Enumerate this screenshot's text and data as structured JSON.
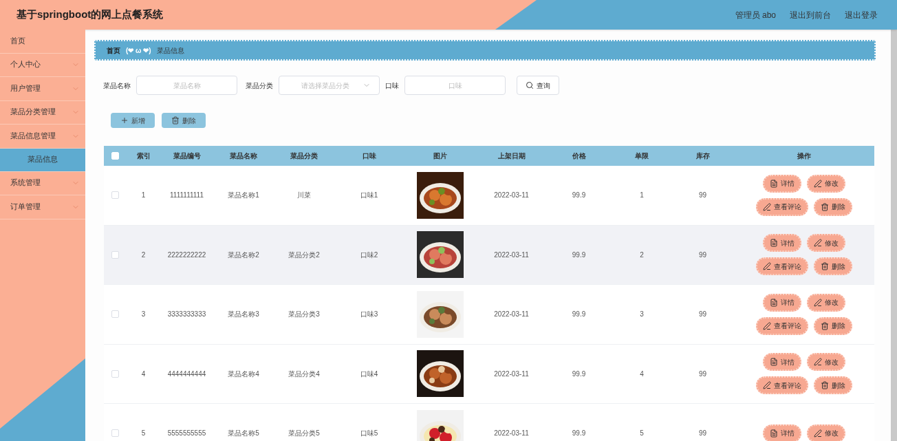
{
  "header": {
    "title": "基于springboot的网上点餐系统",
    "links": [
      "管理员 abo",
      "退出到前台",
      "退出登录"
    ]
  },
  "sidebar": {
    "items": [
      {
        "label": "首页",
        "expandable": false
      },
      {
        "label": "个人中心",
        "expandable": true
      },
      {
        "label": "用户管理",
        "expandable": true
      },
      {
        "label": "菜品分类管理",
        "expandable": true
      },
      {
        "label": "菜品信息管理",
        "expandable": true,
        "children": [
          {
            "label": "菜品信息",
            "selected": true
          }
        ]
      },
      {
        "label": "系统管理",
        "expandable": true
      },
      {
        "label": "订单管理",
        "expandable": true
      }
    ]
  },
  "breadcrumb": {
    "home": "首页",
    "separator": "(❤ ω ❤)",
    "current": "菜品信息"
  },
  "search": {
    "fields": [
      {
        "label": "菜品名称",
        "kind": "input",
        "placeholder": "菜品名称"
      },
      {
        "label": "菜品分类",
        "kind": "select",
        "placeholder": "请选择菜品分类"
      },
      {
        "label": "口味",
        "kind": "input",
        "placeholder": "口味"
      }
    ],
    "button": "查询"
  },
  "toolbar": [
    {
      "kind": "add",
      "label": "新增"
    },
    {
      "kind": "delete",
      "label": "删除"
    }
  ],
  "table": {
    "select_all_checked": false,
    "columns": [
      "索引",
      "菜品编号",
      "菜品名称",
      "菜品分类",
      "口味",
      "图片",
      "上架日期",
      "价格",
      "单限",
      "库存",
      "操作"
    ],
    "rows": [
      {
        "checked": false,
        "hovered": false,
        "cells": [
          "1",
          "1111111111",
          "菜品名称1",
          "川菜",
          "口味1"
        ],
        "picture": {
          "kind": "picture"
        },
        "after": [
          "2022-03-11",
          "99.9",
          "1",
          "99"
        ],
        "actions": [
          {
            "kind": "detail",
            "label": "详情"
          },
          {
            "kind": "edit",
            "label": "修改"
          },
          {
            "kind": "edit",
            "label": "查看评论"
          },
          {
            "kind": "delete",
            "label": "删除"
          }
        ]
      },
      {
        "checked": false,
        "hovered": true,
        "cells": [
          "2",
          "2222222222",
          "菜品名称2",
          "菜品分类2",
          "口味2"
        ],
        "picture": {
          "kind": "picture"
        },
        "after": [
          "2022-03-11",
          "99.9",
          "2",
          "99"
        ],
        "actions": [
          {
            "kind": "detail",
            "label": "详情"
          },
          {
            "kind": "edit",
            "label": "修改"
          },
          {
            "kind": "edit",
            "label": "查看评论"
          },
          {
            "kind": "delete",
            "label": "删除"
          }
        ]
      },
      {
        "checked": false,
        "hovered": false,
        "cells": [
          "3",
          "3333333333",
          "菜品名称3",
          "菜品分类3",
          "口味3"
        ],
        "picture": {
          "kind": "picture"
        },
        "after": [
          "2022-03-11",
          "99.9",
          "3",
          "99"
        ],
        "actions": [
          {
            "kind": "detail",
            "label": "详情"
          },
          {
            "kind": "edit",
            "label": "修改"
          },
          {
            "kind": "edit",
            "label": "查看评论"
          },
          {
            "kind": "delete",
            "label": "删除"
          }
        ]
      },
      {
        "checked": false,
        "hovered": false,
        "cells": [
          "4",
          "4444444444",
          "菜品名称4",
          "菜品分类4",
          "口味4"
        ],
        "picture": {
          "kind": "picture"
        },
        "after": [
          "2022-03-11",
          "99.9",
          "4",
          "99"
        ],
        "actions": [
          {
            "kind": "detail",
            "label": "详情"
          },
          {
            "kind": "edit",
            "label": "修改"
          },
          {
            "kind": "edit",
            "label": "查看评论"
          },
          {
            "kind": "delete",
            "label": "删除"
          }
        ]
      },
      {
        "checked": false,
        "hovered": false,
        "cells": [
          "5",
          "5555555555",
          "菜品名称5",
          "菜品分类5",
          "口味5"
        ],
        "picture": {
          "kind": "picture"
        },
        "after": [
          "2022-03-11",
          "99.9",
          "5",
          "99"
        ],
        "actions": [
          {
            "kind": "detail",
            "label": "详情"
          },
          {
            "kind": "edit",
            "label": "修改"
          }
        ]
      }
    ]
  }
}
